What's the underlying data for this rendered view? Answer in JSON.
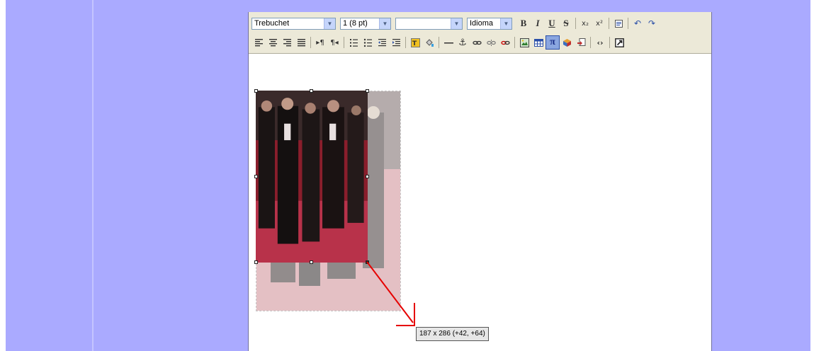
{
  "toolbar": {
    "font_family": "Trebuchet",
    "font_size": "1 (8 pt)",
    "style": "",
    "language": "Idioma",
    "buttons": {
      "bold": "B",
      "italic": "I",
      "underline": "U",
      "strikethrough": "S",
      "subscript": "x₂",
      "superscript": "x²",
      "undo": "↶",
      "redo": "↷"
    }
  },
  "resize": {
    "tooltip": "187 x 286 (+42, +64)"
  },
  "colors": {
    "page_bg": "#aaaaff",
    "toolbar_bg": "#ece9d8",
    "arrow": "#e60000"
  }
}
